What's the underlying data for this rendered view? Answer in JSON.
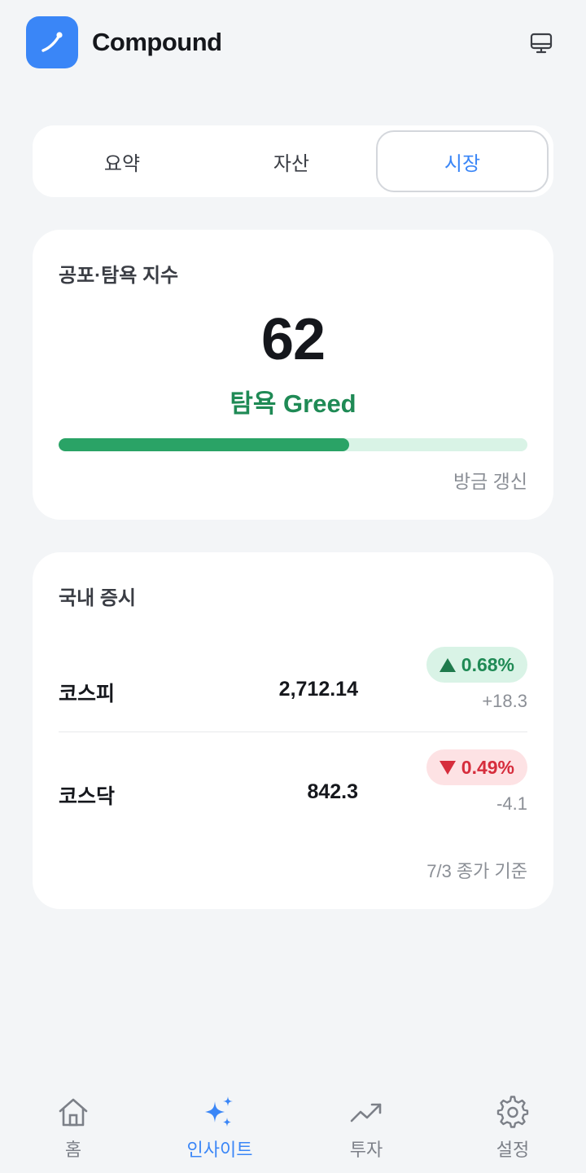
{
  "app": {
    "title": "Compound"
  },
  "tabs": [
    {
      "label": "요약",
      "active": false
    },
    {
      "label": "자산",
      "active": false
    },
    {
      "label": "시장",
      "active": true
    }
  ],
  "fear_greed": {
    "title": "공포·탐욕 지수",
    "value": "62",
    "label": "탐욕 Greed",
    "progress_fraction": 0.62,
    "updated": "방금 갱신"
  },
  "market": {
    "title": "국내 증시",
    "rows": [
      {
        "name": "코스피",
        "price": "2,712.14",
        "direction": "up",
        "percent": "0.68%",
        "change": "+18.3"
      },
      {
        "name": "코스닥",
        "price": "842.3",
        "direction": "down",
        "percent": "0.49%",
        "change": "-4.1"
      }
    ],
    "footnote": "7/3 종가 기준"
  },
  "nav": [
    {
      "label": "홈",
      "icon": "home-icon",
      "active": false
    },
    {
      "label": "인사이트",
      "icon": "sparkles-icon",
      "active": true
    },
    {
      "label": "투자",
      "icon": "trending-up-icon",
      "active": false
    },
    {
      "label": "설정",
      "icon": "gear-icon",
      "active": false
    }
  ],
  "colors": {
    "accent": "#3a86f7",
    "greed": "#1f8a55",
    "up": "#1f8a55",
    "down": "#d62d3c"
  }
}
